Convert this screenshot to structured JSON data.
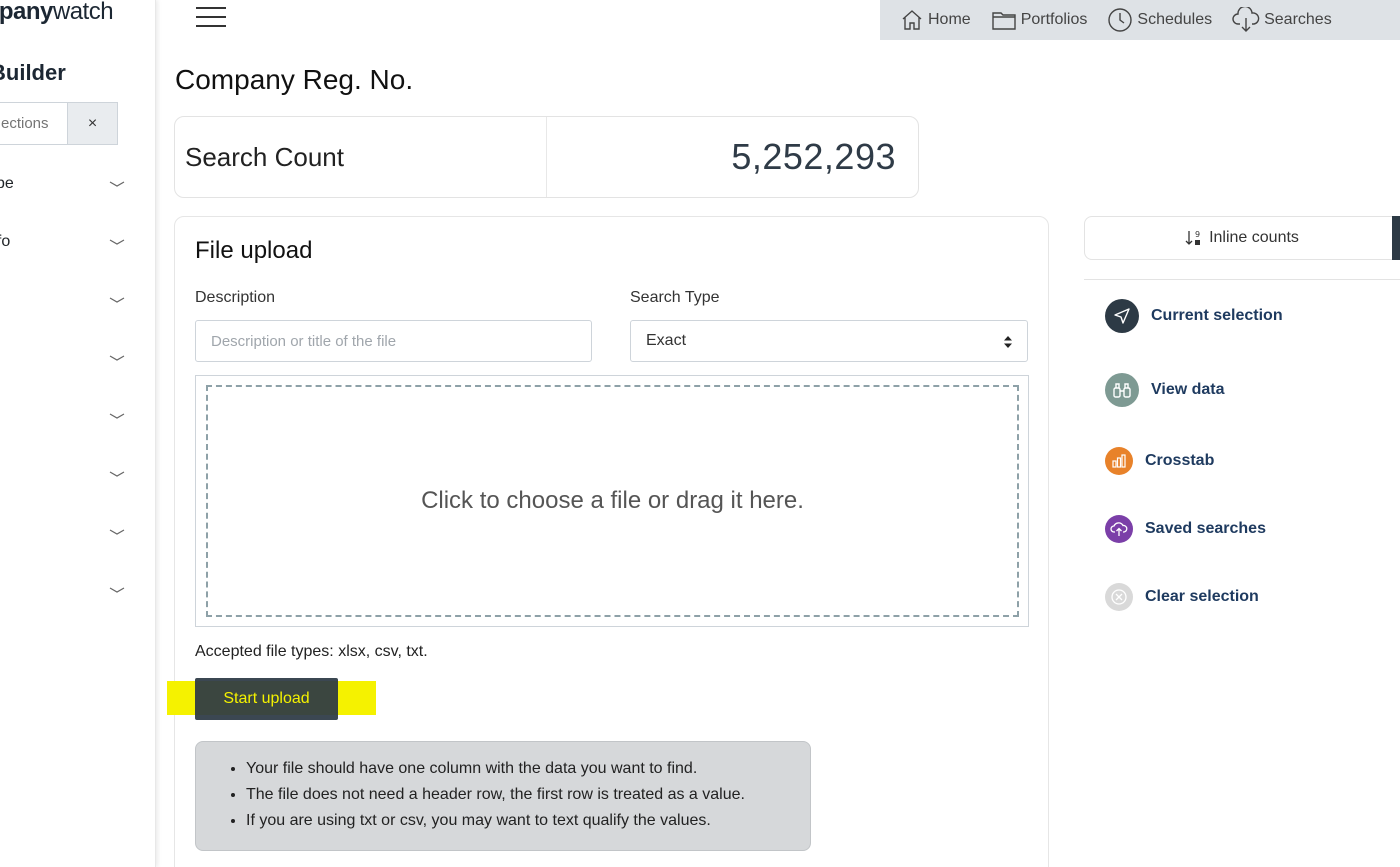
{
  "sidebar": {
    "logo_bold": "mpany",
    "logo_light": "watch",
    "builder_title": "Builder",
    "filter_placeholder": "ections",
    "clear_label": "×",
    "sections": [
      {
        "label": "ype"
      },
      {
        "label": "nfo"
      },
      {
        "label": ""
      },
      {
        "label": ""
      },
      {
        "label": ""
      },
      {
        "label": ""
      },
      {
        "label": ""
      },
      {
        "label": ""
      }
    ]
  },
  "topnav": {
    "items": [
      {
        "label": "Home",
        "icon": "home-icon"
      },
      {
        "label": "Portfolios",
        "icon": "folder-icon"
      },
      {
        "label": "Schedules",
        "icon": "clock-icon"
      },
      {
        "label": "Searches",
        "icon": "cloud-download-icon"
      }
    ]
  },
  "page": {
    "title": "Company Reg. No."
  },
  "count_card": {
    "label": "Search Count",
    "value": "5,252,293"
  },
  "upload": {
    "title": "File upload",
    "description_label": "Description",
    "description_placeholder": "Description or title of the file",
    "search_type_label": "Search Type",
    "search_type_value": "Exact",
    "dropzone_text": "Click to choose a file or drag it here.",
    "accepted_types": "Accepted file types: xlsx, csv, txt.",
    "start_button": "Start upload",
    "tips": [
      "Your file should have one column with the data you want to find.",
      "The file does not need a header row, the first row is treated as a value.",
      "If you are using txt or csv, you may want to text qualify the values."
    ]
  },
  "right_panel": {
    "inline_counts": "Inline counts",
    "actions": [
      {
        "label": "Current selection",
        "icon": "send-icon",
        "color": "#2d3a45"
      },
      {
        "label": "View data",
        "icon": "binoculars-icon",
        "color": "#7e9a93"
      },
      {
        "label": "Crosstab",
        "icon": "bar-chart-icon",
        "color": "#e8822a"
      },
      {
        "label": "Saved searches",
        "icon": "cloud-upload-icon",
        "color": "#7b3fa8"
      },
      {
        "label": "Clear selection",
        "icon": "close-circle-icon",
        "color": "#d9d9d9"
      }
    ]
  },
  "colors": {
    "nav_bg": "#dee2e6",
    "button_bg": "#2d3a45",
    "highlight": "#f5f200",
    "link_text": "#1e3a5f"
  }
}
